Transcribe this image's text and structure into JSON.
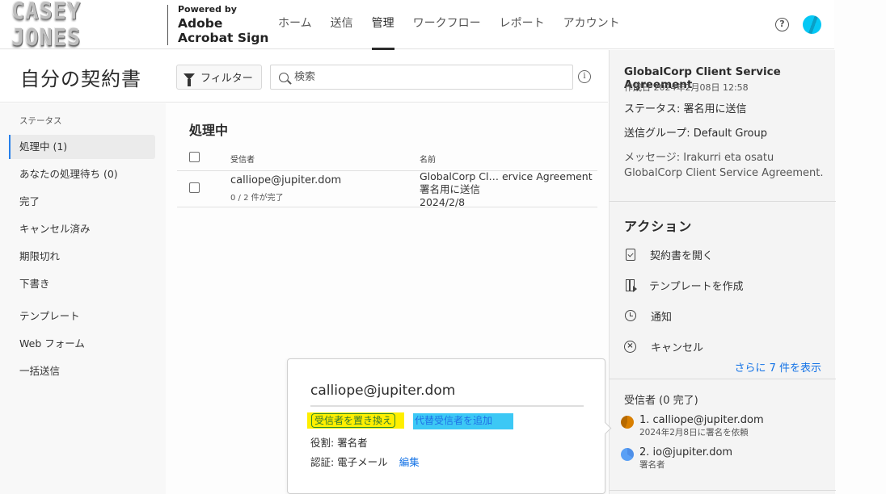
{
  "header": {
    "brand": "CASEY JONES",
    "powered_by": "Powered by",
    "product_line1": "Adobe",
    "product_line2": "Acrobat Sign",
    "nav": [
      {
        "label": "ホーム",
        "active": false
      },
      {
        "label": "送信",
        "active": false
      },
      {
        "label": "管理",
        "active": true
      },
      {
        "label": "ワークフロー",
        "active": false
      },
      {
        "label": "レポート",
        "active": false
      },
      {
        "label": "アカウント",
        "active": false
      }
    ],
    "help_icon": "question-circle-icon",
    "help_glyph": "?",
    "avatar_icon": "user-avatar"
  },
  "page": {
    "title": "自分の契約書",
    "filter_label": "フィルター",
    "search_placeholder": "検索",
    "info_glyph": "i"
  },
  "sidebar": {
    "section_label": "ステータス",
    "items": [
      {
        "label": "処理中 (1)",
        "active": true
      },
      {
        "label": "あなたの処理待ち (0)",
        "active": false
      },
      {
        "label": "完了",
        "active": false
      },
      {
        "label": "キャンセル済み",
        "active": false
      },
      {
        "label": "期限切れ",
        "active": false
      },
      {
        "label": "下書き",
        "active": false
      },
      {
        "label": "テンプレート",
        "active": false
      },
      {
        "label": "Web フォーム",
        "active": false
      },
      {
        "label": "一括送信",
        "active": false
      }
    ]
  },
  "main": {
    "section_title": "処理中",
    "columns": {
      "recipient": "受信者",
      "name": "名前"
    },
    "rows": [
      {
        "recipient": "calliope@jupiter.dom",
        "progress": "0 / 2 件が完了",
        "name": "GlobalCorp Cl… ervice Agreement",
        "status": "署名用に送信",
        "date": "2024/2/8"
      }
    ]
  },
  "details": {
    "title": "GlobalCorp Client Service Agreement",
    "created": "作成日 2024年2月08日 12:58",
    "status_line": "ステータス: 署名用に送信",
    "group_line": "送信グループ: Default Group",
    "message_line": "メッセージ: Irakurri eta osatu GlobalCorp Client Service Agreement.",
    "actions_title": "アクション",
    "actions": [
      {
        "label": "契約書を開く",
        "icon": "document-check-icon"
      },
      {
        "label": "テンプレートを作成",
        "icon": "template-icon"
      },
      {
        "label": "通知",
        "icon": "alarm-clock-icon"
      },
      {
        "label": "キャンセル",
        "icon": "cancel-circle-icon"
      }
    ],
    "show_more": "さらに 7 件を表示",
    "recipients_title": "受信者 (0 完了)",
    "recipients": [
      {
        "label": "1. calliope@jupiter.dom",
        "sub": "2024年2月8日に署名を依頼",
        "color": "#d97f00"
      },
      {
        "label": "2. io@jupiter.dom",
        "sub": "署名者",
        "color": "#4e8fe8"
      }
    ]
  },
  "popover": {
    "email": "calliope@jupiter.dom",
    "replace_label": "受信者を置き換え",
    "add_alternate_label": "代替受信者を追加",
    "role_line": "役割: 署名者",
    "auth_line": "認証: 電子メール",
    "edit_label": "編集",
    "highlight_colors": {
      "replace": "#ffef00",
      "add_alternate": "#3cc8f5"
    }
  }
}
